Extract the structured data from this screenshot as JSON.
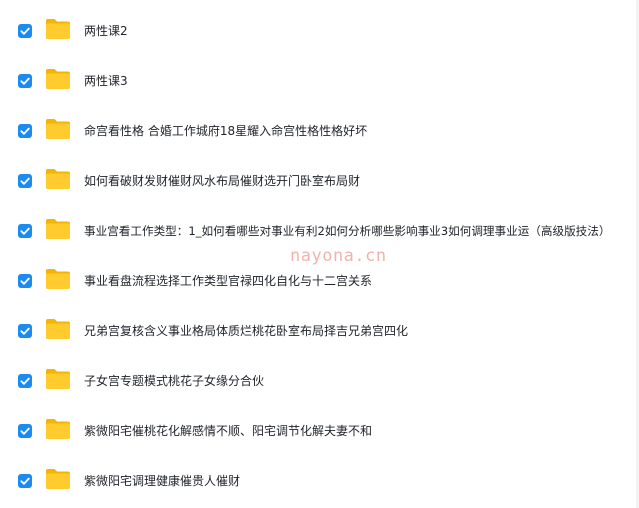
{
  "files": [
    {
      "name": "两性课2",
      "checked": true,
      "icon": "folder-icon"
    },
    {
      "name": "两性课3",
      "checked": true,
      "icon": "folder-icon"
    },
    {
      "name": "命宫看性格 合婚工作城府18星耀入命宫性格性格好坏",
      "checked": true,
      "icon": "folder-icon"
    },
    {
      "name": "如何看破财发财催财风水布局催财选开门卧室布局财",
      "checked": true,
      "icon": "folder-icon"
    },
    {
      "name": "事业宫看工作类型：1_如何看哪些对事业有利2如何分析哪些影响事业3如何调理事业运（高级版技法）",
      "checked": true,
      "icon": "folder-icon"
    },
    {
      "name": "事业看盘流程选择工作类型官禄四化自化与十二宫关系",
      "checked": true,
      "icon": "folder-icon"
    },
    {
      "name": "兄弟宫复核含义事业格局体质烂桃花卧室布局择吉兄弟宫四化",
      "checked": true,
      "icon": "folder-icon"
    },
    {
      "name": "子女宫专题模式桃花子女缘分合伙",
      "checked": true,
      "icon": "folder-icon"
    },
    {
      "name": "紫微阳宅催桃花化解感情不顺、阳宅调节化解夫妻不和",
      "checked": true,
      "icon": "folder-icon"
    },
    {
      "name": "紫微阳宅调理健康催贵人催财",
      "checked": true,
      "icon": "folder-icon"
    }
  ],
  "watermark": "nayona.cn",
  "colors": {
    "checkbox": "#1b8bf0",
    "folder_back": "#f5b400",
    "folder_front": "#ffcb2e",
    "text": "#1f2329",
    "watermark": "#f0a89c"
  }
}
